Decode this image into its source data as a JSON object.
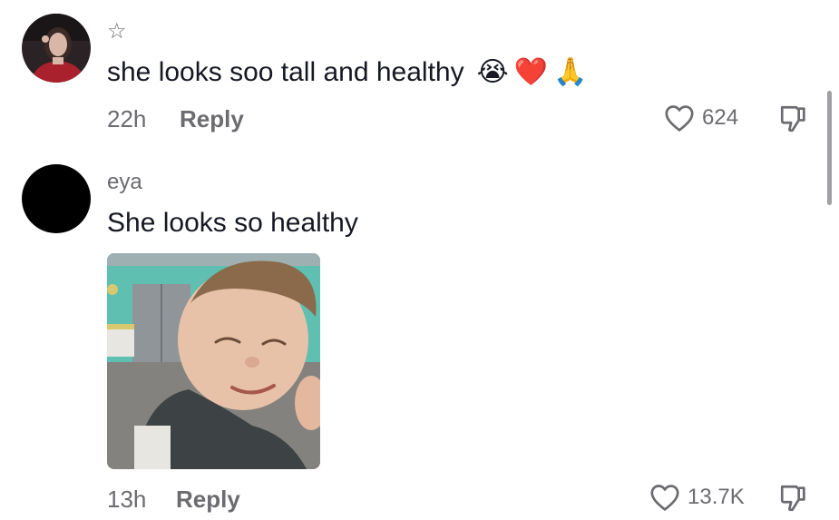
{
  "comments": [
    {
      "username": "☆",
      "text": "she looks soo tall and healthy",
      "emojis": [
        "😭",
        "❤️",
        "🙏"
      ],
      "time": "22h",
      "reply_label": "Reply",
      "like_count": "624"
    },
    {
      "username": "eya",
      "text": "She looks so healthy",
      "time": "13h",
      "reply_label": "Reply",
      "like_count": "13.7K"
    }
  ],
  "colors": {
    "text": "#161823",
    "secondary": "#6b6b70",
    "avatar2": "#000000"
  }
}
